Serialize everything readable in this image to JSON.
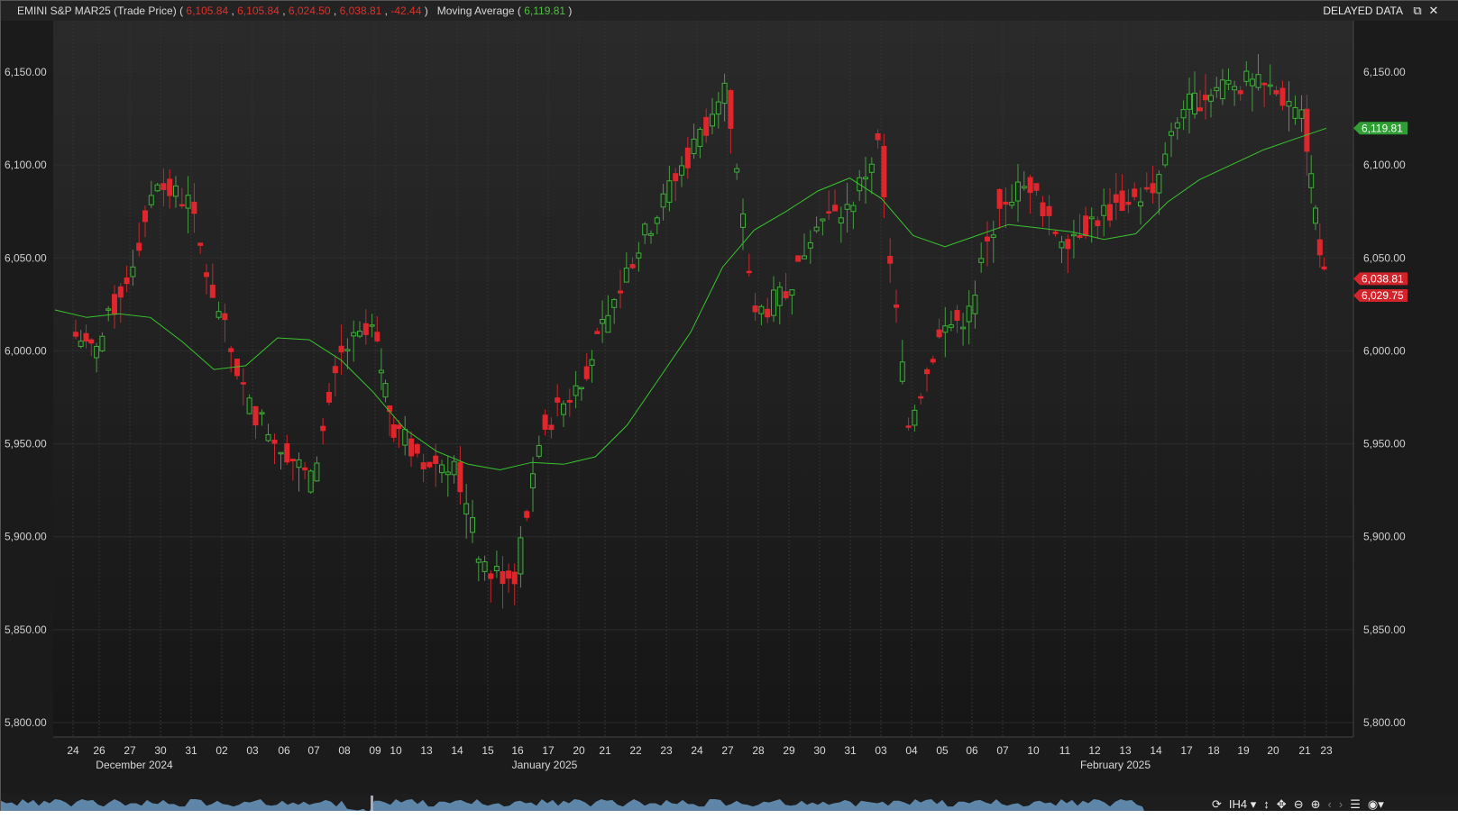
{
  "header": {
    "instrument": "EMINI S&P MAR25 (Trade Price)",
    "open": "6,105.84",
    "high": "6,105.84",
    "low": "6,024.50",
    "close": "6,038.81",
    "change": "-42.44",
    "indicator_name": "Moving Average",
    "indicator_value": "6,119.81",
    "delayed_label": "DELAYED DATA"
  },
  "window_controls": {
    "restore_icon": "restore-icon",
    "close_icon": "close-icon"
  },
  "toolbar": {
    "interval_label": "IH4",
    "icons": [
      "refresh-icon",
      "chevron-down-icon",
      "vertical-scale-icon",
      "pan-icon",
      "zoom-out-icon",
      "zoom-in-icon",
      "prev-icon",
      "next-icon",
      "menu-icon",
      "palette-icon"
    ]
  },
  "colors": {
    "up": "#3fae3a",
    "down": "#e0262d",
    "ma": "#39c42f",
    "background": "#1a1a1a",
    "grid": "#2e2e2e",
    "price_tag_green": "#2f9e34",
    "price_tag_red": "#d0232a"
  },
  "chart_data": {
    "type": "candlestick",
    "title": "EMINI S&P MAR25 (Trade Price)",
    "interval": "1 hour",
    "ylim": [
      5795,
      6160
    ],
    "y_ticks": [
      "6,150.00",
      "6,100.00",
      "6,050.00",
      "6,000.00",
      "5,950.00",
      "5,900.00",
      "5,850.00",
      "5,800.00"
    ],
    "y_tick_values": [
      6150,
      6100,
      6050,
      6000,
      5950,
      5900,
      5850,
      5800
    ],
    "x_day_labels": [
      "24",
      "26",
      "27",
      "30",
      "31",
      "02",
      "03",
      "06",
      "07",
      "08",
      "09",
      "10",
      "13",
      "14",
      "15",
      "16",
      "17",
      "20",
      "21",
      "22",
      "23",
      "24",
      "27",
      "28",
      "29",
      "30",
      "31",
      "03",
      "04",
      "05",
      "06",
      "07",
      "10",
      "11",
      "12",
      "13",
      "14",
      "17",
      "18",
      "19",
      "20",
      "21",
      "23"
    ],
    "x_month_labels": [
      "December 2024",
      "January 2025",
      "February 2025"
    ],
    "daily_closes": [
      6000,
      6040,
      6090,
      6080,
      6020,
      5970,
      5950,
      5930,
      6000,
      6010,
      5960,
      5940,
      5940,
      5880,
      5880,
      5960,
      5980,
      6010,
      6050,
      6080,
      6110,
      6140,
      6020,
      6030,
      6070,
      6075,
      6110,
      5960,
      6010,
      6020,
      6080,
      6090,
      6060,
      6070,
      6080,
      6085,
      6130,
      6140,
      6145,
      6140,
      6130,
      6038.81
    ],
    "moving_average": [
      6022,
      6018,
      6020,
      6018,
      6005,
      5990,
      5992,
      6007,
      6006,
      5995,
      5978,
      5958,
      5946,
      5939,
      5936,
      5940,
      5939,
      5943,
      5960,
      5985,
      6010,
      6045,
      6065,
      6075,
      6086,
      6093,
      6082,
      6062,
      6056,
      6062,
      6068,
      6066,
      6064,
      6060,
      6063,
      6080,
      6092,
      6100,
      6108,
      6114,
      6119.81
    ],
    "series": [
      {
        "name": "EMINI S&P MAR25 (Trade Price)",
        "style": "candles"
      },
      {
        "name": "Moving Average",
        "style": "line"
      }
    ],
    "price_tags": [
      "6,119.81",
      "6,038.81",
      "6,029.75"
    ],
    "grid": true
  }
}
